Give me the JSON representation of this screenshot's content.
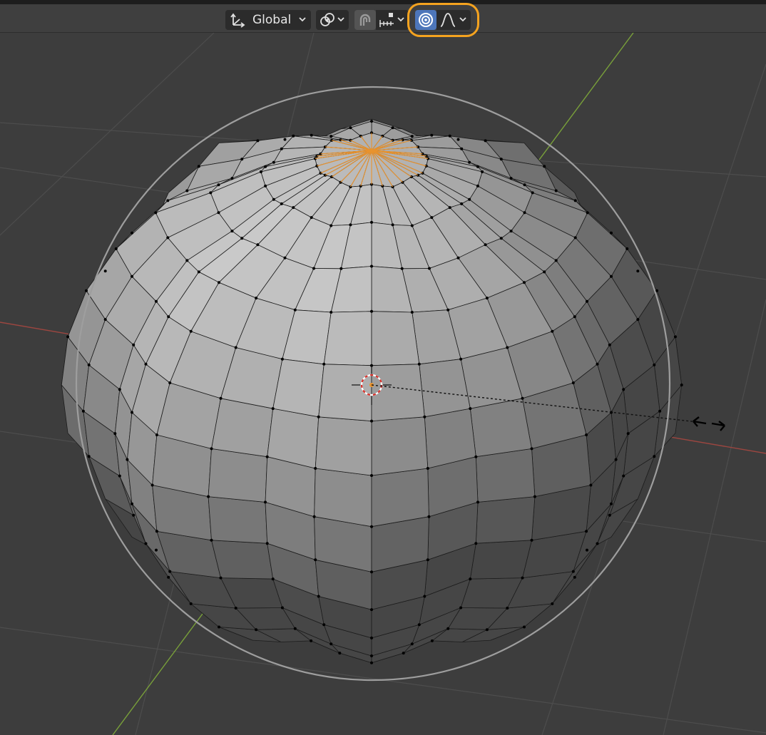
{
  "header": {
    "orientation": {
      "label": "Global"
    }
  },
  "icons": {
    "orientation": "transform-orientation-icon",
    "pivot": "pivot-point-icon",
    "snap": "snap-magnet-icon",
    "snap_target": "snap-increment-icon",
    "proportional": "proportional-editing-icon",
    "falloff": "falloff-smooth-curve-icon",
    "dropdown": "chevron-down-icon"
  },
  "colors": {
    "viewport_bg": "#3d3d3d",
    "header_bg": "#3f3f3f",
    "button_bg": "#2b2b2b",
    "active_toggle": "#4d76ba",
    "annotation_highlight": "#f5a31f",
    "x_axis": "#b0453e",
    "y_axis": "#7ba136",
    "selected_vertex": "#e8932e"
  }
}
